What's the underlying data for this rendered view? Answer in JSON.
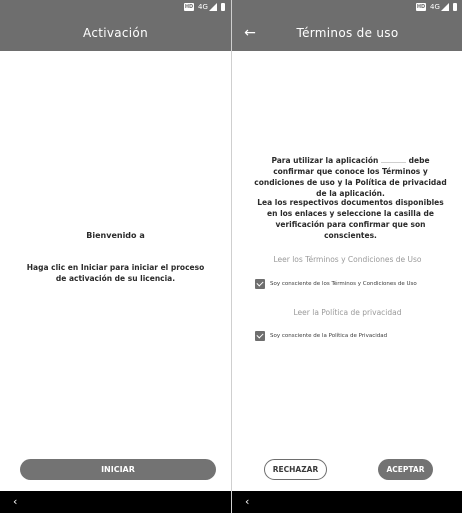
{
  "left_screen": {
    "appbar_title": "Activación",
    "welcome_title": "Bienvenido a",
    "welcome_text": "Haga clic en Iniciar para iniciar el proceso de activación de su licencia.",
    "start_button": "INICIAR"
  },
  "right_screen": {
    "appbar_title": "Términos de uso",
    "intro_before": "Para utilizar la aplicación",
    "intro_after": "debe confirmar que conoce los Términos y condiciones de uso y la Política de privacidad de la aplicación.",
    "docs_text": "Lea los respectivos documentos disponibles en los enlaces y seleccione la casilla de verificación para confirmar que son conscientes.",
    "terms_link": "Leer los Términos y Condiciones de Uso",
    "terms_check_label": "Soy consciente de los Términos y Condiciones de Uso",
    "terms_checked": true,
    "privacy_link": "Leer la Política de privacidad",
    "privacy_check_label": "Soy consciente de la Política de Privacidad",
    "privacy_checked": true,
    "reject_button": "RECHAZAR",
    "accept_button": "ACEPTAR"
  },
  "statusbar": {
    "hd_badge": "HD",
    "network": "4G",
    "icons": [
      "hd-icon",
      "4g-icon",
      "signal-icon",
      "battery-icon"
    ]
  },
  "icons": {
    "back": "arrow-back-icon",
    "nav_back": "nav-back-icon",
    "check": "checkbox-checked-icon"
  },
  "colors": {
    "appbar": "#6e6e6e",
    "button_fill": "#737373",
    "navbar": "#000000",
    "link_text": "#9a9a9a",
    "body_text": "#2a2a2a"
  }
}
